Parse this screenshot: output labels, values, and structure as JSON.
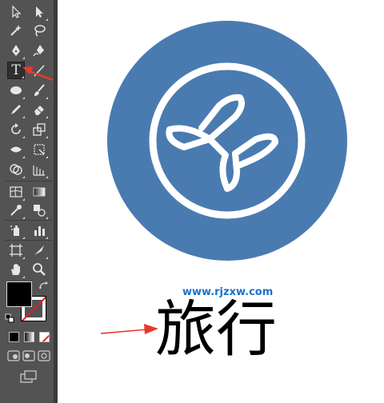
{
  "toolbar": {
    "type_tool_glyph": "T",
    "active_tool": "type-tool"
  },
  "colors": {
    "toolbar_bg": "#535353",
    "fill": "#000000",
    "stroke": "#ffffff",
    "artwork_circle": "#4a7bb0",
    "artwork_outline": "#ffffff",
    "annotation_arrow": "#e83a2c",
    "watermark": "#1a73c9"
  },
  "canvas": {
    "icon": "airplane-in-circle",
    "text": "旅行"
  },
  "watermark": {
    "text": "www.rjzxw.com"
  }
}
